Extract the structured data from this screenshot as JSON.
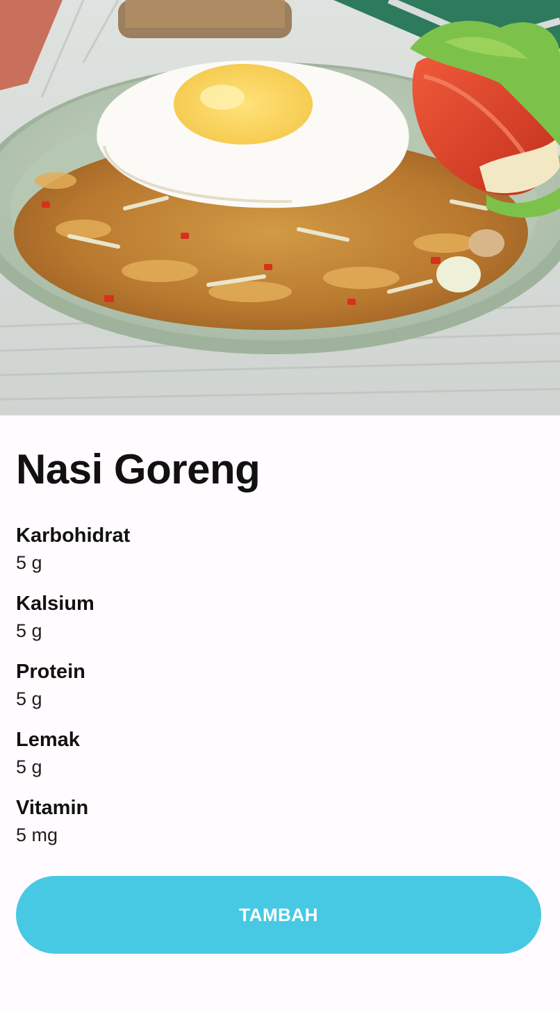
{
  "hero": {
    "image_icon": "food-photo"
  },
  "food": {
    "name": "Nasi Goreng"
  },
  "nutrients": [
    {
      "label": "Karbohidrat",
      "value": "5 g"
    },
    {
      "label": "Kalsium",
      "value": "5 g"
    },
    {
      "label": "Protein",
      "value": "5 g"
    },
    {
      "label": "Lemak",
      "value": "5 g"
    },
    {
      "label": "Vitamin",
      "value": "5 mg"
    }
  ],
  "actions": {
    "add_label": "TAMBAH"
  },
  "colors": {
    "accent": "#48c9e3",
    "background": "#fffbfe",
    "text": "#111111"
  }
}
